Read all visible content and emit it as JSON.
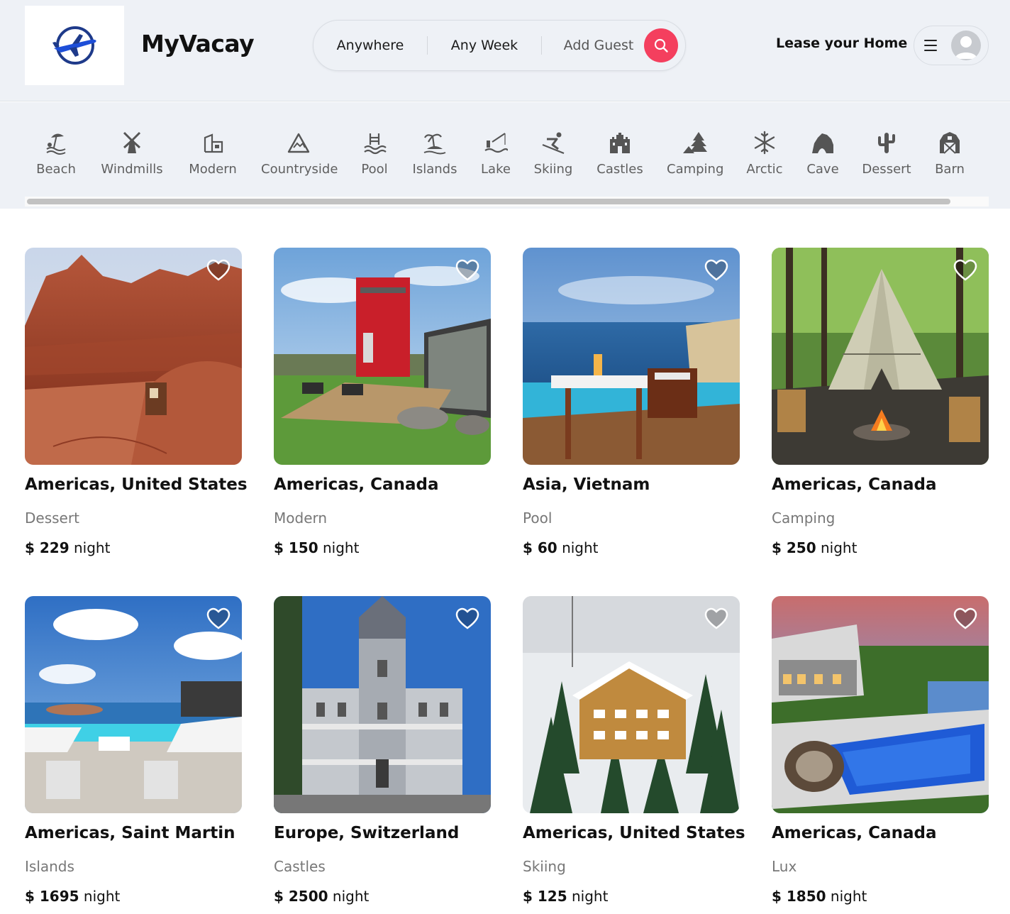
{
  "header": {
    "brand": "MyVacay",
    "search": {
      "location": "Anywhere",
      "week": "Any Week",
      "guests": "Add Guest"
    },
    "lease_label": "Lease your Home",
    "accent_color": "#f43f5e"
  },
  "categories": [
    {
      "label": "Beach",
      "icon": "beach-icon"
    },
    {
      "label": "Windmills",
      "icon": "windmill-icon"
    },
    {
      "label": "Modern",
      "icon": "modern-house-icon"
    },
    {
      "label": "Countryside",
      "icon": "mountain-icon"
    },
    {
      "label": "Pool",
      "icon": "pool-icon"
    },
    {
      "label": "Islands",
      "icon": "island-icon"
    },
    {
      "label": "Lake",
      "icon": "lake-icon"
    },
    {
      "label": "Skiing",
      "icon": "skiing-icon"
    },
    {
      "label": "Castles",
      "icon": "castle-icon"
    },
    {
      "label": "Camping",
      "icon": "camping-icon"
    },
    {
      "label": "Arctic",
      "icon": "snowflake-icon"
    },
    {
      "label": "Cave",
      "icon": "cave-icon"
    },
    {
      "label": "Dessert",
      "icon": "cactus-icon"
    },
    {
      "label": "Barn",
      "icon": "barn-icon"
    }
  ],
  "listings": [
    {
      "location": "Americas, United States",
      "category": "Dessert",
      "price": "$ 229",
      "unit": "night"
    },
    {
      "location": "Americas, Canada",
      "category": "Modern",
      "price": "$ 150",
      "unit": "night"
    },
    {
      "location": "Asia, Vietnam",
      "category": "Pool",
      "price": "$ 60",
      "unit": "night"
    },
    {
      "location": "Americas, Canada",
      "category": "Camping",
      "price": "$ 250",
      "unit": "night"
    },
    {
      "location": "Americas, Saint Martin",
      "category": "Islands",
      "price": "$ 1695",
      "unit": "night"
    },
    {
      "location": "Europe, Switzerland",
      "category": "Castles",
      "price": "$ 2500",
      "unit": "night"
    },
    {
      "location": "Americas, United States",
      "category": "Skiing",
      "price": "$ 125",
      "unit": "night"
    },
    {
      "location": "Americas, Canada",
      "category": "Lux",
      "price": "$ 1850",
      "unit": "night"
    }
  ]
}
